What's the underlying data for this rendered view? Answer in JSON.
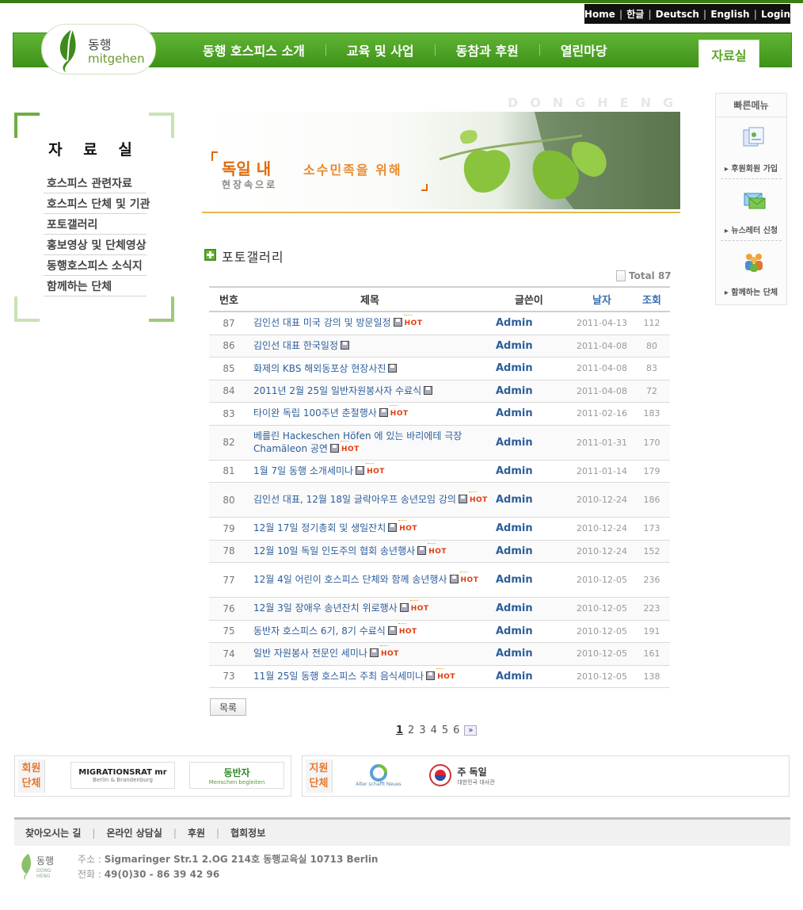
{
  "top_links": [
    "Home",
    "한글",
    "Deutsch",
    "English",
    "Login"
  ],
  "logo": {
    "ko": "동행",
    "en": "mitgehen"
  },
  "menu": [
    "동행 호스피스 소개",
    "교육 및 사업",
    "동참과 후원",
    "열린마당"
  ],
  "menu_active": "자료실",
  "sidebar": {
    "title": "자 료 실",
    "items": [
      "호스피스 관련자료",
      "호스피스 단체 및 기관",
      "포토갤러리",
      "홍보영상 및 단체영상",
      "동행호스피스 소식지",
      "함께하는 단체"
    ]
  },
  "banner": {
    "watermark": "DONGHENG",
    "line1a": "독일 내",
    "line1b": "소수민족을 위해",
    "line2": "현장속으로"
  },
  "section_title": "포토갤러리",
  "total": "Total 87",
  "table": {
    "headers": {
      "no": "번호",
      "title": "제목",
      "author": "글쓴이",
      "date": "날자",
      "views": "조회"
    },
    "rows": [
      {
        "no": "87",
        "title": "김인선 대표 미국 강의 및 방문일정",
        "hot": true,
        "author": "Admin",
        "date": "2011-04-13",
        "views": "112"
      },
      {
        "no": "86",
        "title": "김인선 대표 한국일정",
        "hot": false,
        "author": "Admin",
        "date": "2011-04-08",
        "views": "80"
      },
      {
        "no": "85",
        "title": "화제의 KBS 해외동포상 현장사진",
        "hot": false,
        "author": "Admin",
        "date": "2011-04-08",
        "views": "83"
      },
      {
        "no": "84",
        "title": "2011년 2월 25일 일반자원봉사자 수료식",
        "hot": false,
        "author": "Admin",
        "date": "2011-04-08",
        "views": "72"
      },
      {
        "no": "83",
        "title": "타이완 독립 100주년 춘절행사",
        "hot": true,
        "author": "Admin",
        "date": "2011-02-16",
        "views": "183"
      },
      {
        "no": "82",
        "title": "베를린 Hackeschen Höfen 에 있는 바리에테 극장 Chamäleon 공연",
        "hot": true,
        "author": "Admin",
        "date": "2011-01-31",
        "views": "170"
      },
      {
        "no": "81",
        "title": "1월 7일 동행 소개세미나",
        "hot": true,
        "author": "Admin",
        "date": "2011-01-14",
        "views": "179"
      },
      {
        "no": "80",
        "title": "김인선 대표, 12월 18일 글락아우프 송년모임 강의",
        "hot": true,
        "author": "Admin",
        "date": "2010-12-24",
        "views": "186"
      },
      {
        "no": "79",
        "title": "12월 17일 정기총회 및 생일잔치",
        "hot": true,
        "author": "Admin",
        "date": "2010-12-24",
        "views": "173"
      },
      {
        "no": "78",
        "title": "12월 10일 독일 인도주의 협회 송년행사",
        "hot": true,
        "author": "Admin",
        "date": "2010-12-24",
        "views": "152"
      },
      {
        "no": "77",
        "title": "12월 4일 어린이 호스피스 단체와 함께 송년행사",
        "hot": true,
        "author": "Admin",
        "date": "2010-12-05",
        "views": "236"
      },
      {
        "no": "76",
        "title": "12월 3일 장애우 송년잔치 위로행사",
        "hot": true,
        "author": "Admin",
        "date": "2010-12-05",
        "views": "223"
      },
      {
        "no": "75",
        "title": "동반자 호스피스 6기, 8기 수료식",
        "hot": true,
        "author": "Admin",
        "date": "2010-12-05",
        "views": "191"
      },
      {
        "no": "74",
        "title": "일반 자원봉사 전문인 세미나",
        "hot": true,
        "author": "Admin",
        "date": "2010-12-05",
        "views": "161"
      },
      {
        "no": "73",
        "title": "11월 25일 동행 호스피스 주최 음식세미나",
        "hot": true,
        "author": "Admin",
        "date": "2010-12-05",
        "views": "138"
      }
    ]
  },
  "hot_label": "HOT",
  "list_button": "목록",
  "pager": {
    "pages": [
      "1",
      "2",
      "3",
      "4",
      "5",
      "6"
    ],
    "current": "1",
    "next": "»"
  },
  "quick_menu": {
    "title": "빠른메뉴",
    "items": [
      "후원회원 가입",
      "뉴스레터 신청",
      "함께하는 단체"
    ]
  },
  "partners": {
    "member_label": "회원 단체",
    "member_logos": [
      "MIGRATIONSRAT mr",
      "동반자"
    ],
    "member_logo_sub": [
      "Berlin & Brandenburg",
      "Menschen begleiten"
    ],
    "support_label": "지원 단체",
    "support_logos": [
      "Alter schafft Neues",
      "주 독일"
    ],
    "support_logo_sub": [
      "대한민국 대사관"
    ]
  },
  "footer": {
    "links": [
      "찾아오시는 길",
      "온라인 상담실",
      "후원",
      "협회정보"
    ],
    "address_label": "주소 :",
    "address": "Sigmaringer Str.1 2.OG 214호 동행교육실 10713 Berlin",
    "phone_label": "전화 :",
    "phone": "49(0)30 - 86 39 42 96",
    "logo_ko": "동행",
    "logo_en": "DONG HENG"
  },
  "colors": {
    "brand_green": "#4fa326",
    "accent_orange": "#e06a0c",
    "link_blue": "#2d5e9a"
  }
}
